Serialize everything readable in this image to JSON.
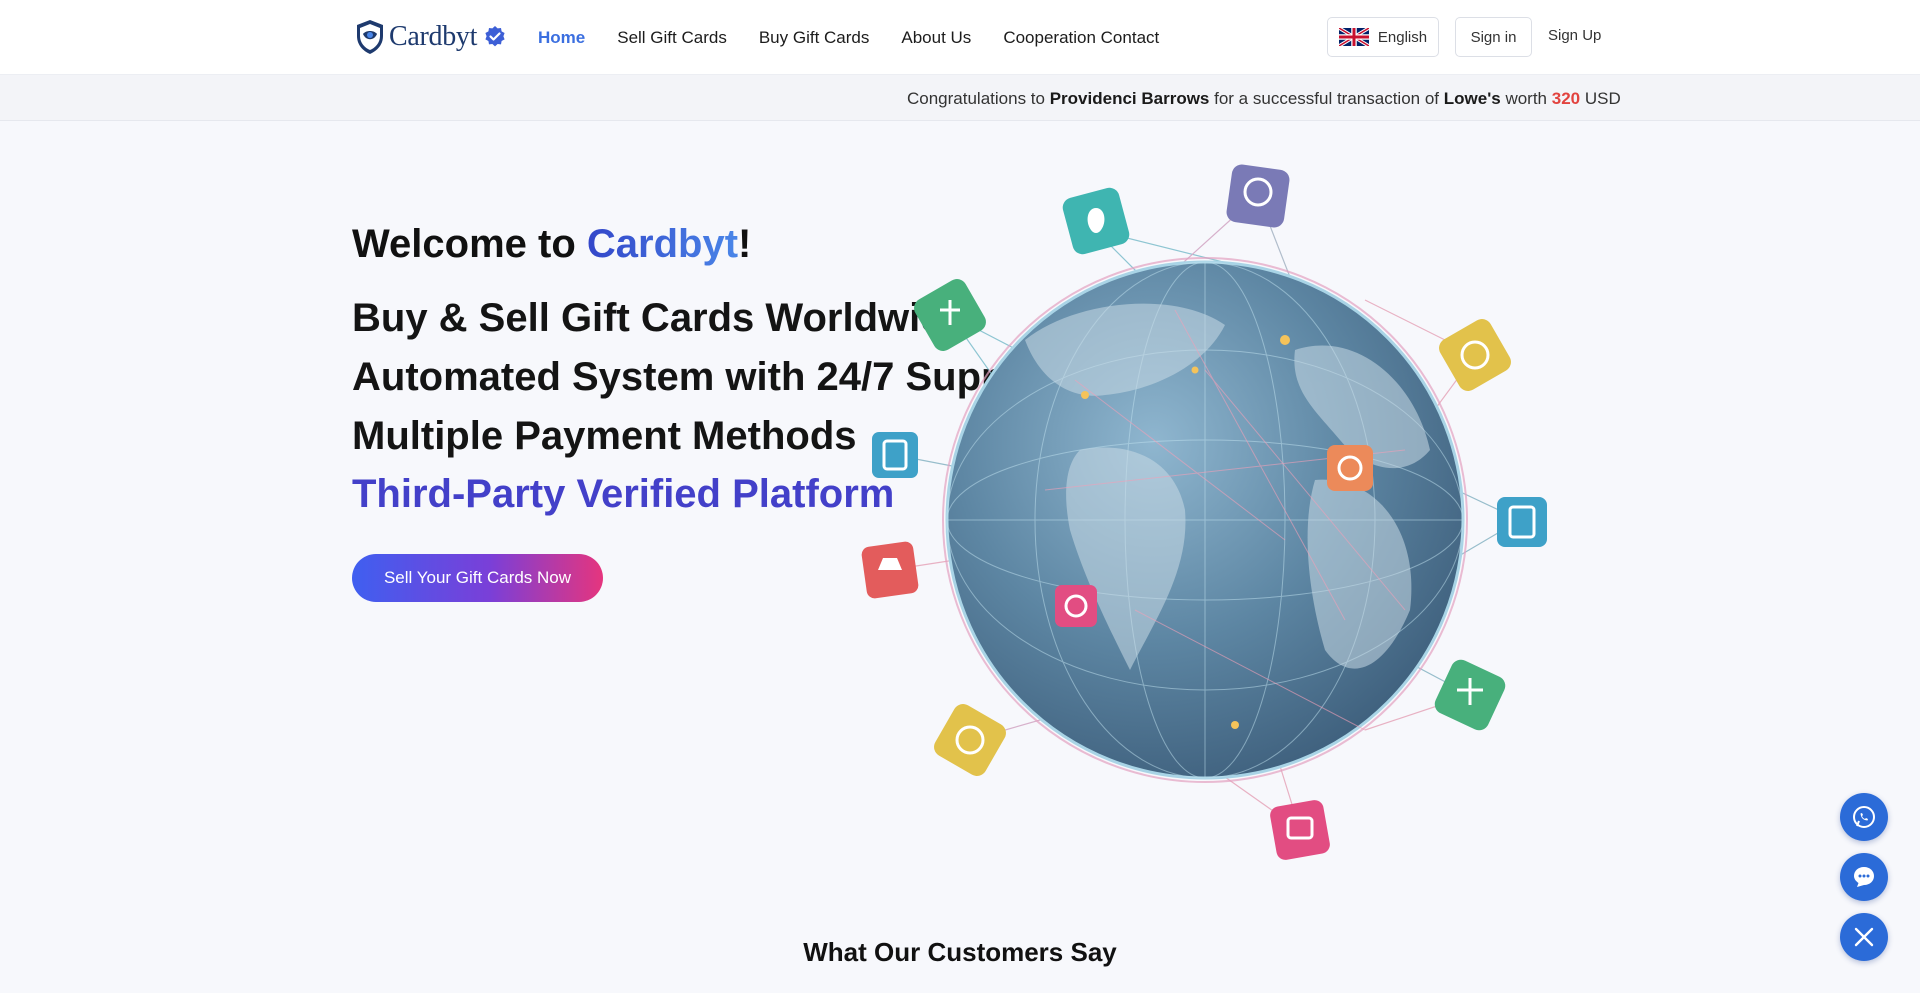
{
  "header": {
    "brand": "Cardbyt",
    "nav": [
      "Home",
      "Sell Gift Cards",
      "Buy Gift Cards",
      "About Us",
      "Cooperation Contact"
    ],
    "language": "English",
    "signin": "Sign in",
    "signup": "Sign Up"
  },
  "ticker": {
    "prefix": "Congratulations to",
    "name": "Providenci Barrows",
    "middle": "for a successful transaction of",
    "card": "Lowe's",
    "worth": "worth",
    "amount": "320",
    "currency": "USD"
  },
  "hero": {
    "welcome_prefix": "Welcome to",
    "brand": "Cardbyt",
    "welcome_suffix": "!",
    "lines": [
      "Buy & Sell Gift Cards Worldwide",
      "Automated System with 24/7 Support",
      "Multiple Payment Methods",
      "Third-Party Verified Platform"
    ],
    "cta": "Sell Your Gift Cards Now"
  },
  "section_title": "What Our Customers Say",
  "colors": {
    "accent": "#3b6fe0",
    "highlight": "#4340c9",
    "amount": "#e2433f",
    "fab": "#2b6bd8"
  },
  "icons": [
    "apple-card-icon",
    "xbox-card-icon",
    "steam-card-icon",
    "gift-card-icon",
    "chat-icon",
    "whatsapp-icon",
    "close-icon"
  ]
}
